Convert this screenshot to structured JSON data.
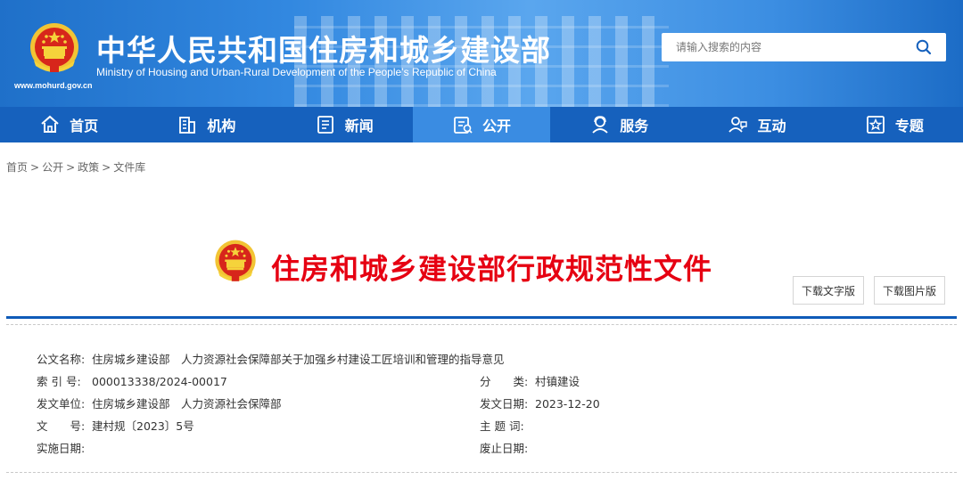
{
  "header": {
    "title": "中华人民共和国住房和城乡建设部",
    "subtitle": "Ministry of Housing and Urban-Rural Development of the People’s Republic of China",
    "url": "www.mohurd.gov.cn",
    "search_placeholder": "请输入搜索的内容"
  },
  "nav": [
    {
      "label": "首页",
      "icon": "home-icon"
    },
    {
      "label": "机构",
      "icon": "building-icon"
    },
    {
      "label": "新闻",
      "icon": "news-icon"
    },
    {
      "label": "公开",
      "icon": "disclosure-icon",
      "active": true
    },
    {
      "label": "服务",
      "icon": "service-icon"
    },
    {
      "label": "互动",
      "icon": "interaction-icon"
    },
    {
      "label": "专题",
      "icon": "topic-star-icon"
    }
  ],
  "breadcrumb": [
    "首页",
    "公开",
    "政策",
    "文件库"
  ],
  "breadcrumb_separator": ">",
  "doc": {
    "title": "住房和城乡建设部行政规范性文件",
    "download_text_label": "下载文字版",
    "download_image_label": "下载图片版"
  },
  "metadata": {
    "name_label": "公文名称:",
    "name_value": "住房城乡建设部　人力资源社会保障部关于加强乡村建设工匠培训和管理的指导意见",
    "index_label": "索 引 号:",
    "index_value": "000013338/2024-00017",
    "category_label": "分　　类:",
    "category_value": "村镇建设",
    "issuer_label": "发文单位:",
    "issuer_value": "住房城乡建设部　人力资源社会保障部",
    "date_label": "发文日期:",
    "date_value": "2023-12-20",
    "docno_label": "文　　号:",
    "docno_value": "建村规〔2023〕5号",
    "keywords_label": "主 题 词:",
    "keywords_value": "",
    "effective_label": "实施日期:",
    "effective_value": "",
    "expiry_label": "废止日期:",
    "expiry_value": ""
  },
  "colors": {
    "header_blue": "#2a7fd8",
    "nav_blue": "#1661bd",
    "nav_active": "#3a8ce2",
    "title_red": "#e60012",
    "rule_blue": "#0f5bb8"
  }
}
